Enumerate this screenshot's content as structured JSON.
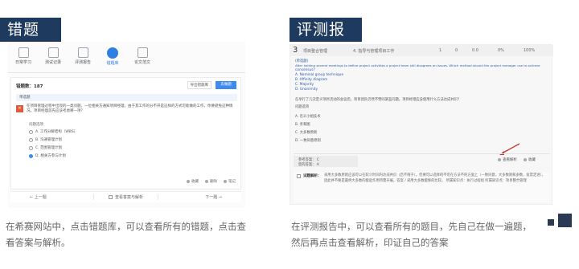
{
  "badges": {
    "left": "错题库",
    "right": "评测报告"
  },
  "left_panel": {
    "nav": [
      {
        "label": "日常学习",
        "icon": "book-icon"
      },
      {
        "label": "测试记录",
        "icon": "record-icon"
      },
      {
        "label": "评测报告",
        "icon": "report-icon"
      },
      {
        "label": "错题库",
        "icon": "wrong-book-icon",
        "active": true
      },
      {
        "label": "论文范文",
        "icon": "paper-icon"
      }
    ],
    "header": "错题数：187",
    "export_label": "导出错题库",
    "blue_button": "去做题",
    "strip": "单选题",
    "question": "在项目管理过程中出现的一类问题。一位相关方通知项目经理，由于其工作的分不开是这样的方式可能做的工作，你要避免这种情况，项目经理首先应该考虑哪一项？",
    "options_label": "问题选项",
    "options": [
      {
        "text": "A. 工作分解结构（WBS）",
        "selected": false
      },
      {
        "text": "B. 沟通管理计划",
        "selected": false
      },
      {
        "text": "C. 范围管理计划",
        "selected": false
      },
      {
        "text": "D. 相关方参与计划",
        "selected": true
      }
    ],
    "footer": {
      "collect": "收藏",
      "delete": "删除",
      "note": "笔记"
    },
    "pager": {
      "prev": "←  上一题",
      "mid": "查看答案与解析",
      "next": "下一题  →"
    }
  },
  "right_panel": {
    "q_number": "3",
    "head_title": "项目整合管理",
    "head_sub": "4. 指导与管理项目工作",
    "head_cols": [
      "1",
      "0",
      "0.0",
      "0%",
      "100%"
    ],
    "lines": [
      {
        "text": "(单选题)",
        "blue": true
      },
      {
        "text": "After holding several meetings to define project activities a project team still disagrees on issues. Which method should the project manager use to achieve",
        "blue": true
      },
      {
        "text": "consensus?",
        "blue": true
      },
      {
        "text": "A. Nominal group technique",
        "blue": true
      },
      {
        "text": "B. Affinity diagram",
        "blue": true
      },
      {
        "text": "C. Majority",
        "blue": true
      },
      {
        "text": "D. Unanimity",
        "blue": true
      },
      {
        "text": "在举行了几次定义项目活动的会议后，项目团队仍然不赞同某些问题。项目经理应该使用什么方法达成共识？",
        "blue": false
      },
      {
        "text": "问题选项",
        "blue": false
      },
      {
        "text": "A. 名义小组技术",
        "blue": false
      },
      {
        "text": "B. 亲和图",
        "blue": false
      },
      {
        "text": "C. 大多数原则",
        "blue": false
      },
      {
        "text": "D. 一致同意原则",
        "blue": false
      }
    ],
    "see_analysis": "查看解析",
    "favorite": "收藏",
    "answer_ref": "参考答案：  C",
    "answer_mine": "您的答案：  A",
    "analysis_label": "试题解析：",
    "analysis_text": "采用大多数原则应该可以在较少时间内达成共识（后不限于）。但要可以选择的不可在方法不的方面上（一致同意，大多数则和多数，投票定进），因此并不要是最终大多数的能起作用所需开展。答案 / 采用大多数能够的比较。 所属知识点：执行过程组 所属知识点：项目整合管理"
  },
  "captions": {
    "left": "在希赛网站中，点击错题库，可以查看所有的错题，点击查看答案与解析。",
    "right": "在评测报告中，可以查看所有的题目，先自己在做一遍题，然后再点击查看解析，印证自己的答案"
  }
}
